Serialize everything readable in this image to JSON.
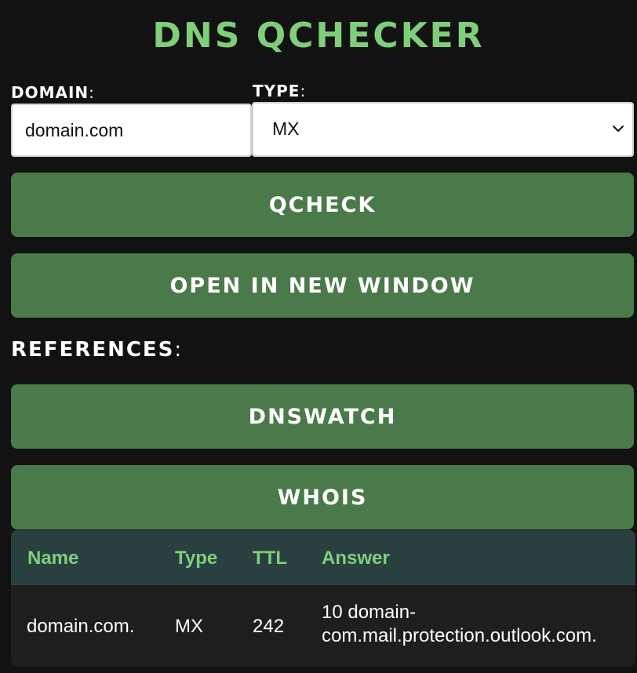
{
  "app": {
    "title": "DNS QCHECKER"
  },
  "form": {
    "domain_label": "DOMAIN",
    "domain_colon": ":",
    "domain_value": "domain.com",
    "type_label": "TYPE",
    "type_colon": ":",
    "type_value": "MX",
    "qcheck_label": "QCHECK",
    "open_window_label": "OPEN IN NEW WINDOW"
  },
  "references": {
    "label": "REFERENCES",
    "colon": ":",
    "dnswatch_label": "DNSWATCH",
    "whois_label": "WHOIS"
  },
  "results": {
    "columns": [
      "Name",
      "Type",
      "TTL",
      "Answer"
    ],
    "rows": [
      {
        "name": "domain.com.",
        "type": "MX",
        "ttl": "242",
        "answer_line1": "10 domain-",
        "answer_line2": "com.mail.protection.outlook.com."
      }
    ]
  },
  "colors": {
    "background": "#121212",
    "accent_green": "#7fcf7a",
    "button_green": "#4a7a4a",
    "table_header": "#2a4040"
  },
  "icons": {
    "select_arrow": "chevron-down-icon"
  }
}
